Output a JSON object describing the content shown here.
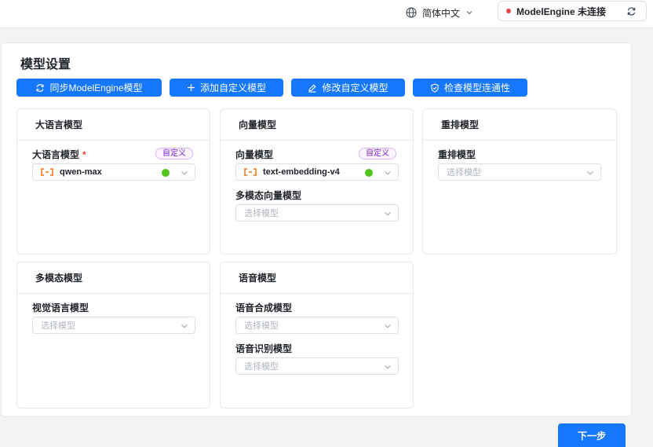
{
  "header": {
    "language": "简体中文",
    "connection_label": "ModelEngine 未连接",
    "connection_status_color": "#ef4444"
  },
  "page": {
    "title": "模型设置",
    "next_label": "下一步"
  },
  "toolbar": {
    "sync_label": "同步ModelEngine模型",
    "add_label": "添加自定义模型",
    "edit_label": "修改自定义模型",
    "check_label": "检查模型连通性"
  },
  "cards": {
    "llm": {
      "title": "大语言模型",
      "field_label": "大语言模型",
      "required_mark": "*",
      "tag": "自定义",
      "value": "qwen-max"
    },
    "embedding": {
      "title": "向量模型",
      "field_label": "向量模型",
      "tag": "自定义",
      "value": "text-embedding-v4",
      "multi_label": "多模态向量模型",
      "multi_placeholder": "选择模型"
    },
    "rerank": {
      "title": "重排模型",
      "field_label": "重排模型",
      "placeholder": "选择模型"
    },
    "multimodal": {
      "title": "多模态模型",
      "field_label": "视觉语言模型",
      "placeholder": "选择模型"
    },
    "voice": {
      "title": "语音模型",
      "tts_label": "语音合成模型",
      "tts_placeholder": "选择模型",
      "asr_label": "语音识别模型",
      "asr_placeholder": "选择模型"
    }
  },
  "colors": {
    "primary": "#1677ff",
    "status_ok": "#52c41a",
    "model_icon": "#f97316",
    "tag_text": "#7e22ce"
  }
}
